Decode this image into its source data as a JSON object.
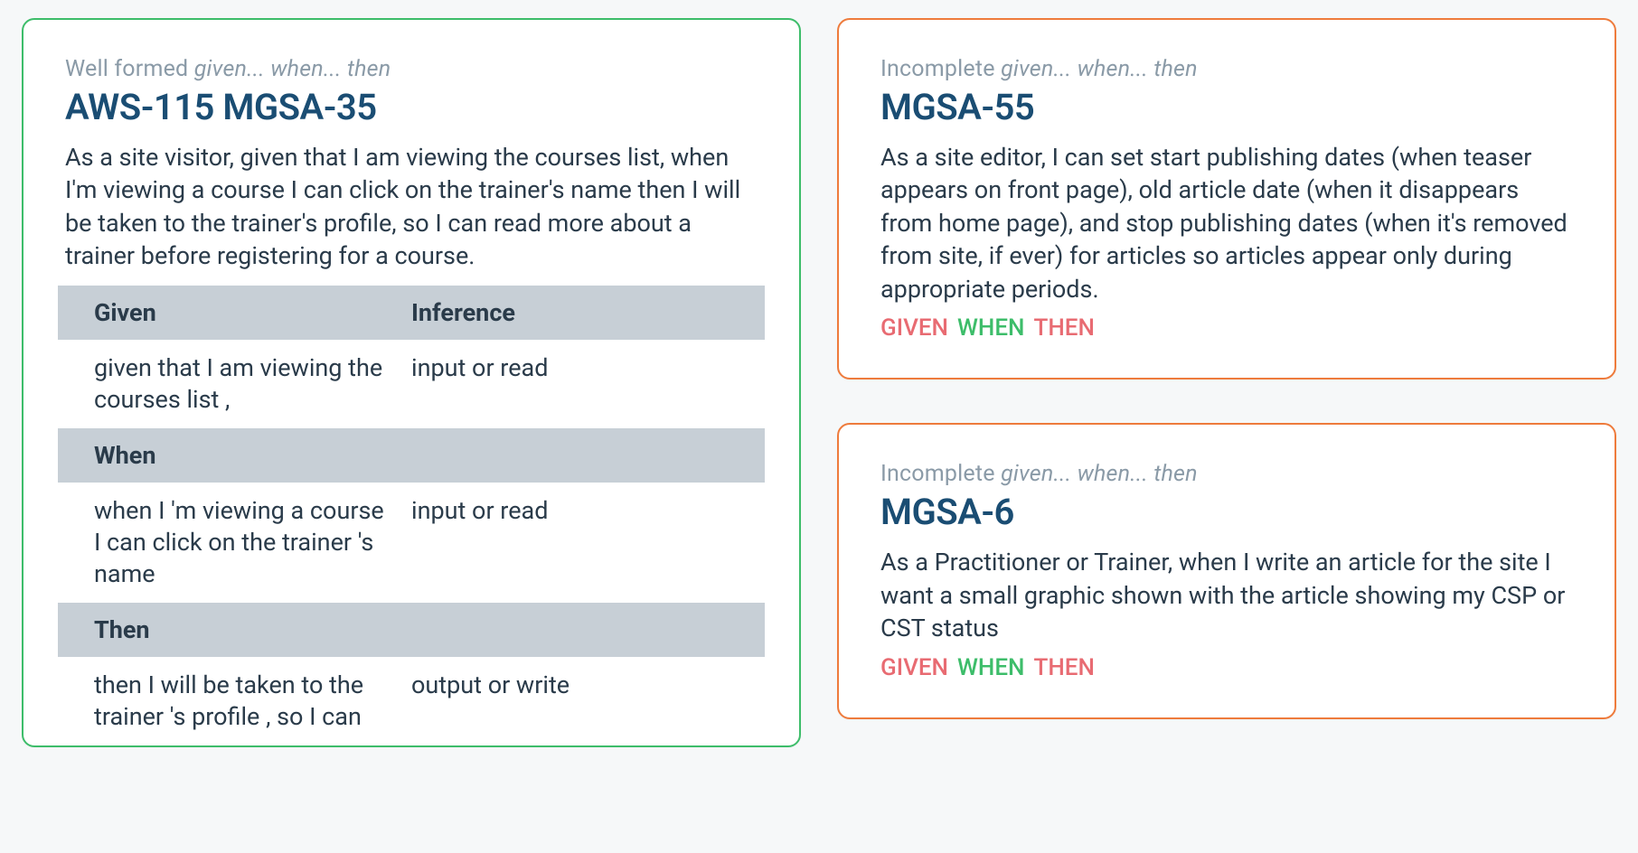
{
  "statusLabels": {
    "wellFormedPrefix": "Well formed ",
    "incompletePrefix": "Incomplete ",
    "italicPart": "given... when... then"
  },
  "tags": {
    "given": "GIVEN",
    "when": "WHEN",
    "then": "THEN"
  },
  "leftCard": {
    "title": "AWS-115 MGSA-35",
    "body": "As a site visitor, given that I am viewing the courses list, when I'm viewing a course I can click on the trainer's name then I will be taken to the trainer's profile, so I can read more about a trainer before registering for a course.",
    "table": {
      "headers": {
        "left": "Given",
        "right": "Inference"
      },
      "given": {
        "text": "given that I am viewing the courses list ,",
        "inference": "input or read"
      },
      "whenHeader": "When",
      "when": {
        "text": "when I 'm viewing a course I can click on the trainer 's name",
        "inference": "input or read"
      },
      "thenHeader": "Then",
      "then": {
        "text": "then I will be taken to the trainer 's profile , so I can",
        "inference": "output or write"
      }
    }
  },
  "rightCards": [
    {
      "title": "MGSA-55",
      "body": "As a site editor, I can set start publishing dates (when teaser appears on front page), old article date (when it disappears from home page), and stop publishing dates (when it's removed from site, if ever) for articles so articles appear only during appropriate periods."
    },
    {
      "title": "MGSA-6",
      "body": "As a Practitioner or Trainer, when I write an article for the site I want a small graphic shown with the article showing my CSP or CST status"
    }
  ]
}
